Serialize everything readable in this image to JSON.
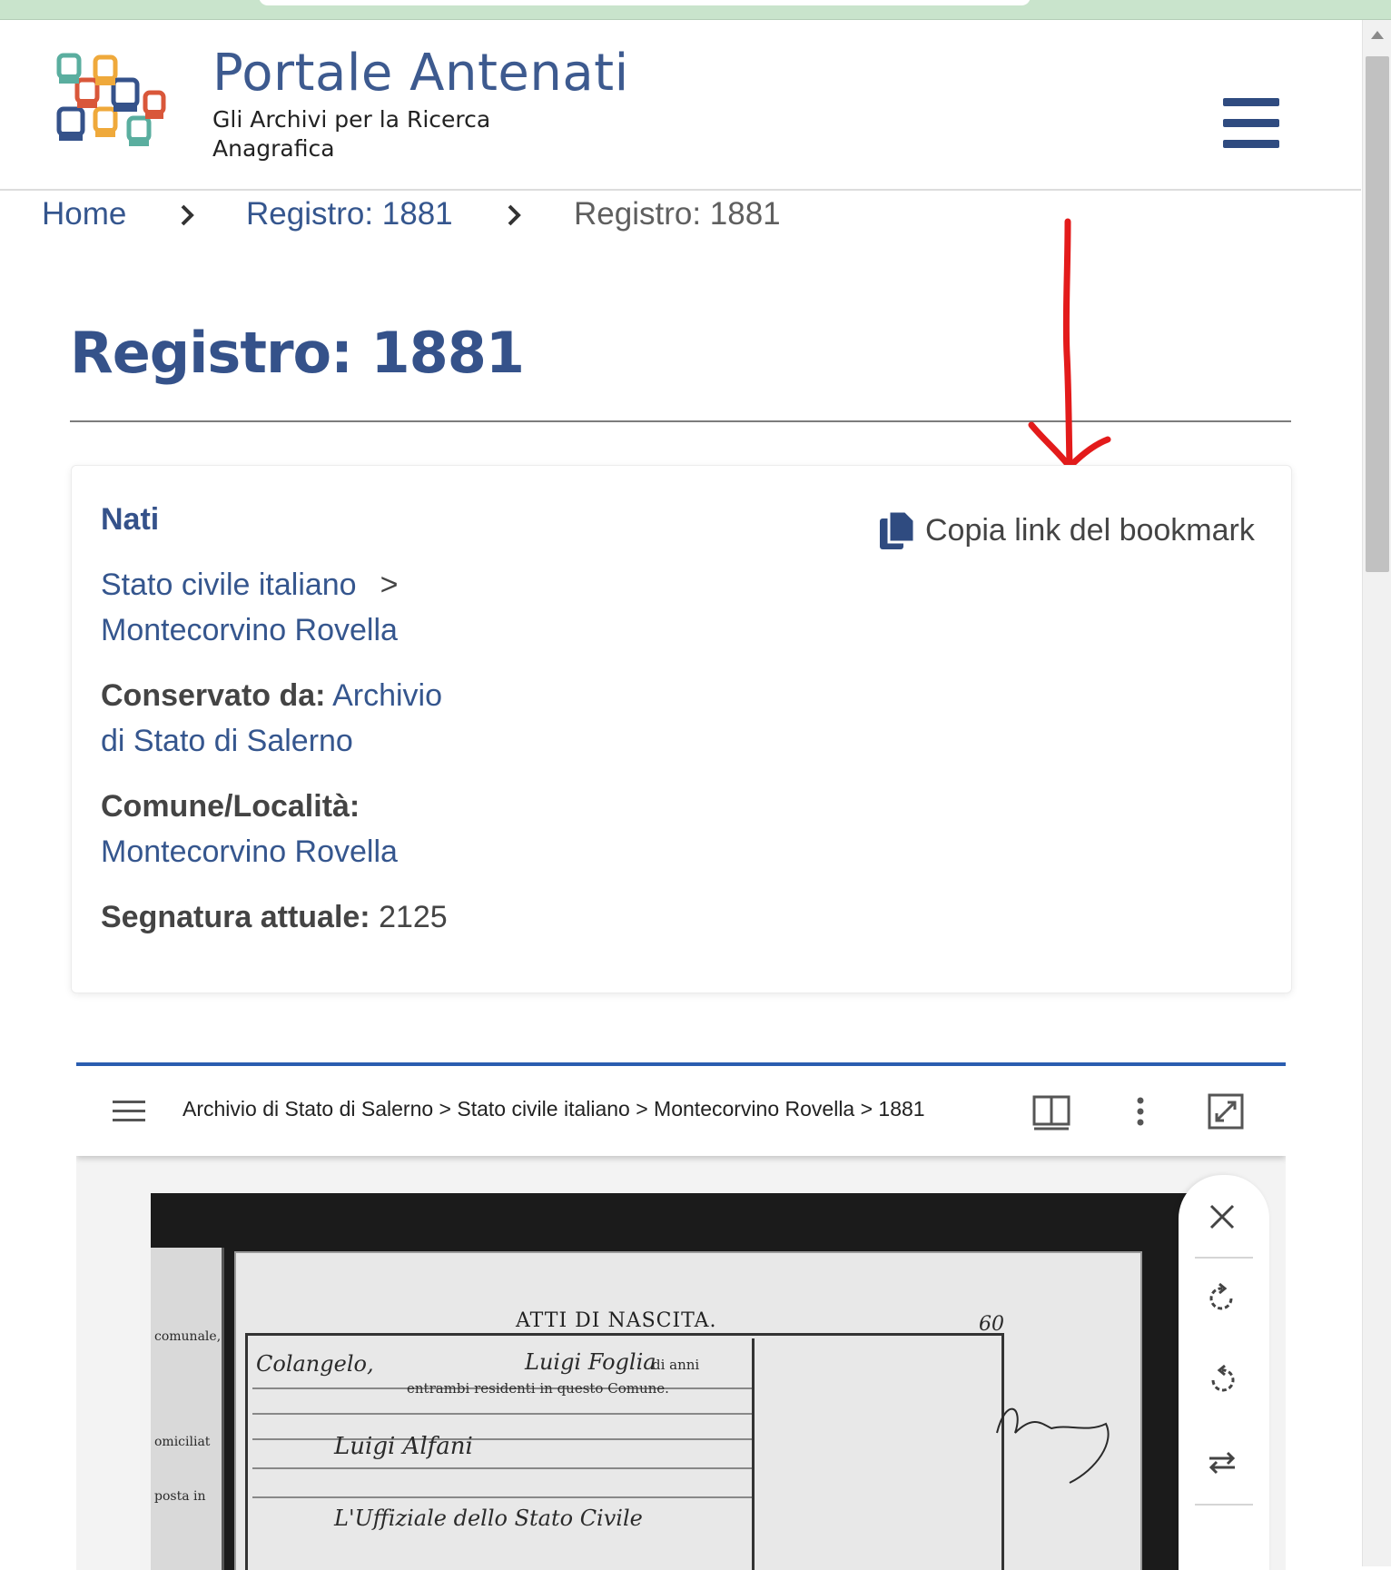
{
  "header": {
    "title": "Portale Antenati",
    "subtitle": "Gli Archivi per la Ricerca Anagrafica"
  },
  "breadcrumb": [
    "Home",
    "Registro: 1881",
    "Registro: 1881"
  ],
  "page": {
    "title": "Registro: 1881"
  },
  "card": {
    "heading": "Nati",
    "fonds_link_1": "Stato civile italiano",
    "fonds_sep": ">",
    "fonds_link_2": "Montecorvino Rovella",
    "conservato_label": "Conservato da:",
    "conservato_value": "Archivio di Stato di Salerno",
    "comune_label": "Comune/Località:",
    "comune_value": "Montecorvino Rovella",
    "segnatura_label": "Segnatura attuale:",
    "segnatura_value": "2125",
    "copy_link": "Copia link del bookmark"
  },
  "viewer": {
    "breadcrumb": "Archivio di Stato di Salerno > Stato civile italiano > Montecorvino Rovella > 1881",
    "accent_color": "#2a5db0",
    "scan": {
      "heading": "ATTI DI NASCITA.",
      "page_number": "60",
      "left_margin_words": [
        "comunale,",
        "omiciliat",
        "posta in"
      ],
      "print_line_1": "di anni",
      "print_line_2": "entrambi residenti in questo Comune.",
      "hand_1": "Colangelo,",
      "hand_2": "Luigi Foglia",
      "hand_3": "Luigi Alfani",
      "hand_4": "L'Uffiziale dello Stato Civile"
    }
  },
  "colors": {
    "brand_blue": "#35528a",
    "annotation_red": "#e31b1b"
  }
}
